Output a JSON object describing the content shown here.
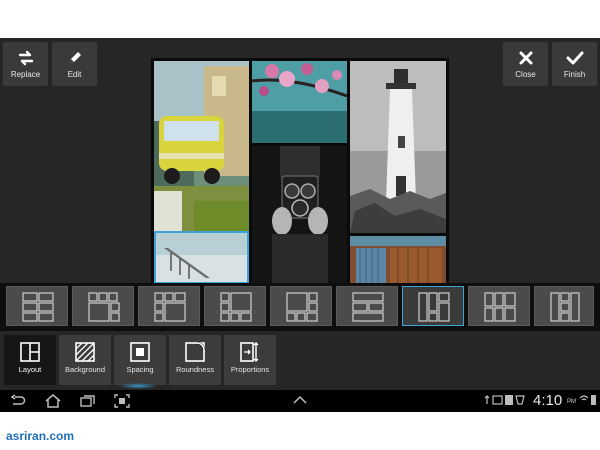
{
  "toolbar": {
    "replace_label": "Replace",
    "edit_label": "Edit",
    "close_label": "Close",
    "finish_label": "Finish"
  },
  "layouts": {
    "count": 9,
    "selected_index": 6
  },
  "tools": [
    {
      "label": "Layout",
      "icon": "layout-icon",
      "active": true
    },
    {
      "label": "Background",
      "icon": "background-icon",
      "active": false
    },
    {
      "label": "Spacing",
      "icon": "spacing-icon",
      "active": false
    },
    {
      "label": "Roundness",
      "icon": "roundness-icon",
      "active": false
    },
    {
      "label": "Proportions",
      "icon": "proportions-icon",
      "active": false
    }
  ],
  "status": {
    "time": "4:10",
    "ampm": "PM"
  },
  "watermark": "asriran.com",
  "colors": {
    "accent": "#3ba3d9",
    "app_bg": "#262626",
    "button_bg": "#3c3c3c"
  }
}
